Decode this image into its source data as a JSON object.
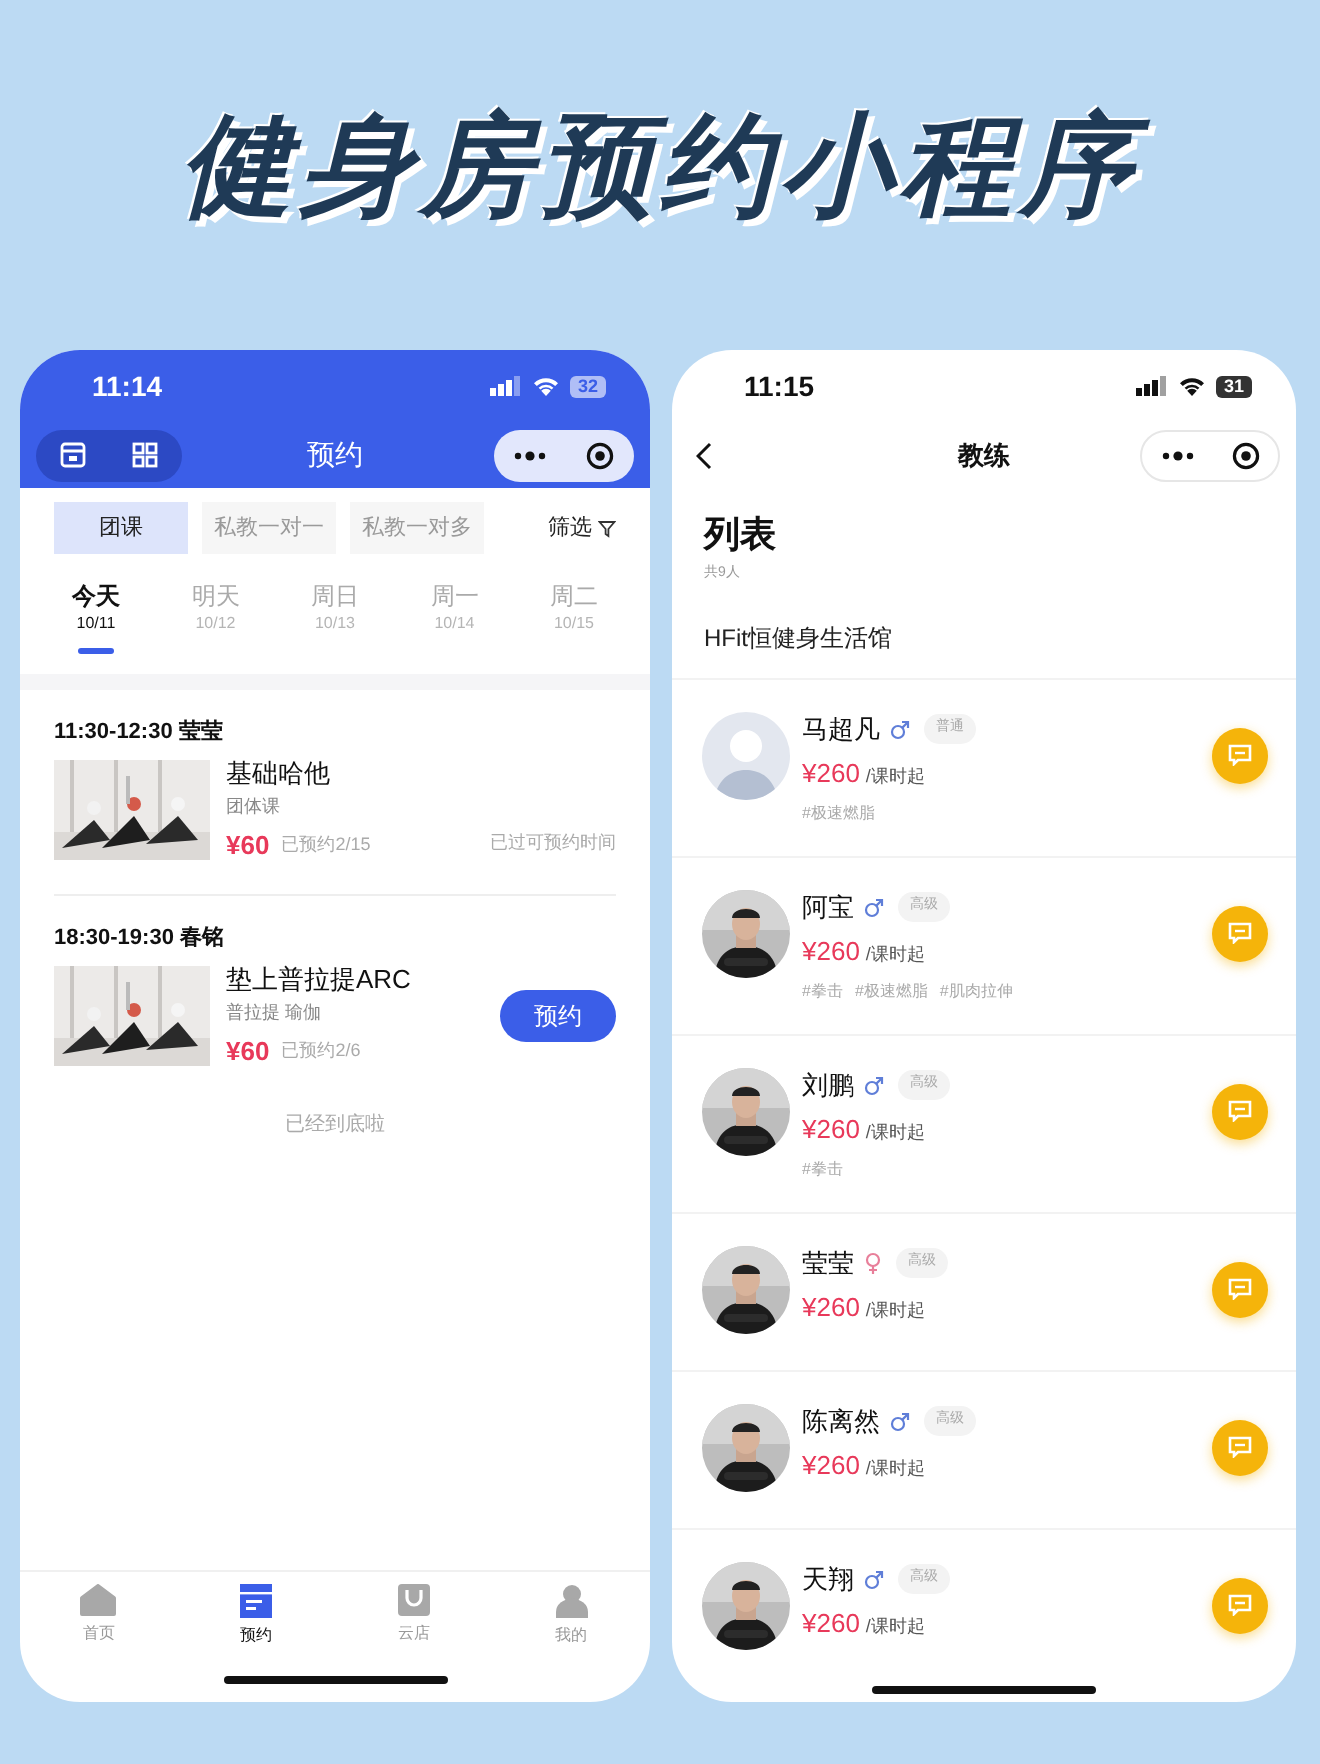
{
  "headline": "健身房预约小程序",
  "booking_screen": {
    "status_bar": {
      "time": "11:14",
      "battery": "32"
    },
    "nav_title": "预约",
    "categories": [
      {
        "label": "团课",
        "selected": true
      },
      {
        "label": "私教一对一",
        "selected": false
      },
      {
        "label": "私教一对多",
        "selected": false
      }
    ],
    "filter": "筛选",
    "days": [
      {
        "label": "今天",
        "date": "10/11",
        "selected": true
      },
      {
        "label": "明天",
        "date": "10/12",
        "selected": false
      },
      {
        "label": "周日",
        "date": "10/13",
        "selected": false
      },
      {
        "label": "周一",
        "date": "10/14",
        "selected": false
      },
      {
        "label": "周二",
        "date": "10/15",
        "selected": false
      }
    ],
    "classes": [
      {
        "time": "11:30-12:30",
        "coach": "莹莹",
        "title": "基础哈他",
        "tags": "团体课",
        "price": "¥60",
        "booked": "已预约2/15",
        "action": {
          "kind": "note",
          "label": "已过可预约时间"
        }
      },
      {
        "time": "18:30-19:30",
        "coach": "春铭",
        "title": "垫上普拉提ARC",
        "tags": "普拉提 瑜伽",
        "price": "¥60",
        "booked": "已预约2/6",
        "action": {
          "kind": "button",
          "label": "预约"
        }
      }
    ],
    "end_note": "已经到底啦",
    "tab_bar": [
      {
        "label": "首页",
        "kind": "home",
        "selected": false
      },
      {
        "label": "预约",
        "kind": "calendar",
        "selected": true
      },
      {
        "label": "云店",
        "kind": "bag",
        "selected": false
      },
      {
        "label": "我的",
        "kind": "person",
        "selected": false
      }
    ]
  },
  "coach_screen": {
    "status_bar": {
      "time": "11:15",
      "battery": "31"
    },
    "nav_title": "教练",
    "heading": "列表",
    "count": "共9人",
    "gym": "HFit恒健身生活馆",
    "coaches": [
      {
        "name": "马超凡",
        "kind": "male",
        "level": "普通",
        "price": "¥260",
        "unit": "/课时起",
        "tags": [
          "#极速燃脂"
        ],
        "has_photo": false
      },
      {
        "name": "阿宝",
        "kind": "male",
        "level": "高级",
        "price": "¥260",
        "unit": "/课时起",
        "tags": [
          "#拳击",
          "#极速燃脂",
          "#肌肉拉伸"
        ],
        "has_photo": true
      },
      {
        "name": "刘鹏",
        "kind": "male",
        "level": "高级",
        "price": "¥260",
        "unit": "/课时起",
        "tags": [
          "#拳击"
        ],
        "has_photo": true
      },
      {
        "name": "莹莹",
        "kind": "female",
        "level": "高级",
        "price": "¥260",
        "unit": "/课时起",
        "has_photo": true
      },
      {
        "name": "陈离然",
        "kind": "male",
        "level": "高级",
        "price": "¥260",
        "unit": "/课时起",
        "has_photo": true
      },
      {
        "name": "天翔",
        "kind": "male",
        "level": "高级",
        "price": "¥260",
        "unit": "/课时起",
        "has_photo": true
      }
    ]
  }
}
